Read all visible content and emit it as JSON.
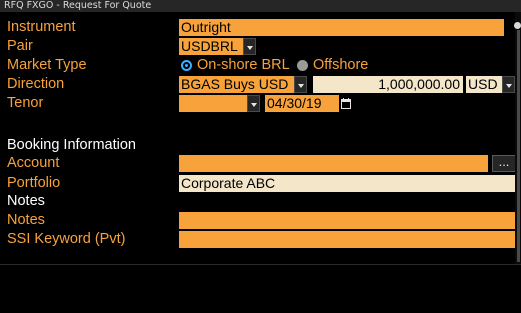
{
  "window": {
    "title": "RFQ FXGO - Request For Quote"
  },
  "form": {
    "instrument": {
      "label": "Instrument",
      "value": "Outright"
    },
    "pair": {
      "label": "Pair",
      "value": "USDBRL"
    },
    "market_type": {
      "label": "Market Type",
      "options": [
        "On-shore BRL",
        "Offshore"
      ],
      "selected": "On-shore BRL"
    },
    "direction": {
      "label": "Direction",
      "value": "BGAS Buys USD",
      "amount": "1,000,000.00",
      "currency": "USD"
    },
    "tenor": {
      "label": "Tenor",
      "value": "",
      "date": "04/30/19"
    }
  },
  "booking": {
    "section_title": "Booking Information",
    "account": {
      "label": "Account",
      "value": "",
      "more": "..."
    },
    "portfolio": {
      "label": "Portfolio",
      "value": "Corporate ABC"
    }
  },
  "notes": {
    "section_title": "Notes",
    "notes_field": {
      "label": "Notes",
      "value": ""
    },
    "ssi_keyword": {
      "label": "SSI Keyword (Pvt)",
      "value": ""
    }
  },
  "colors": {
    "accent": "#f7a23b",
    "field_tan": "#f3e6c9",
    "radio_on": "#3ab0ff",
    "background": "#000000"
  },
  "icons": [
    "chevron-down-icon",
    "calendar-icon",
    "radio-on-icon",
    "radio-off-icon",
    "ellipsis-icon"
  ]
}
